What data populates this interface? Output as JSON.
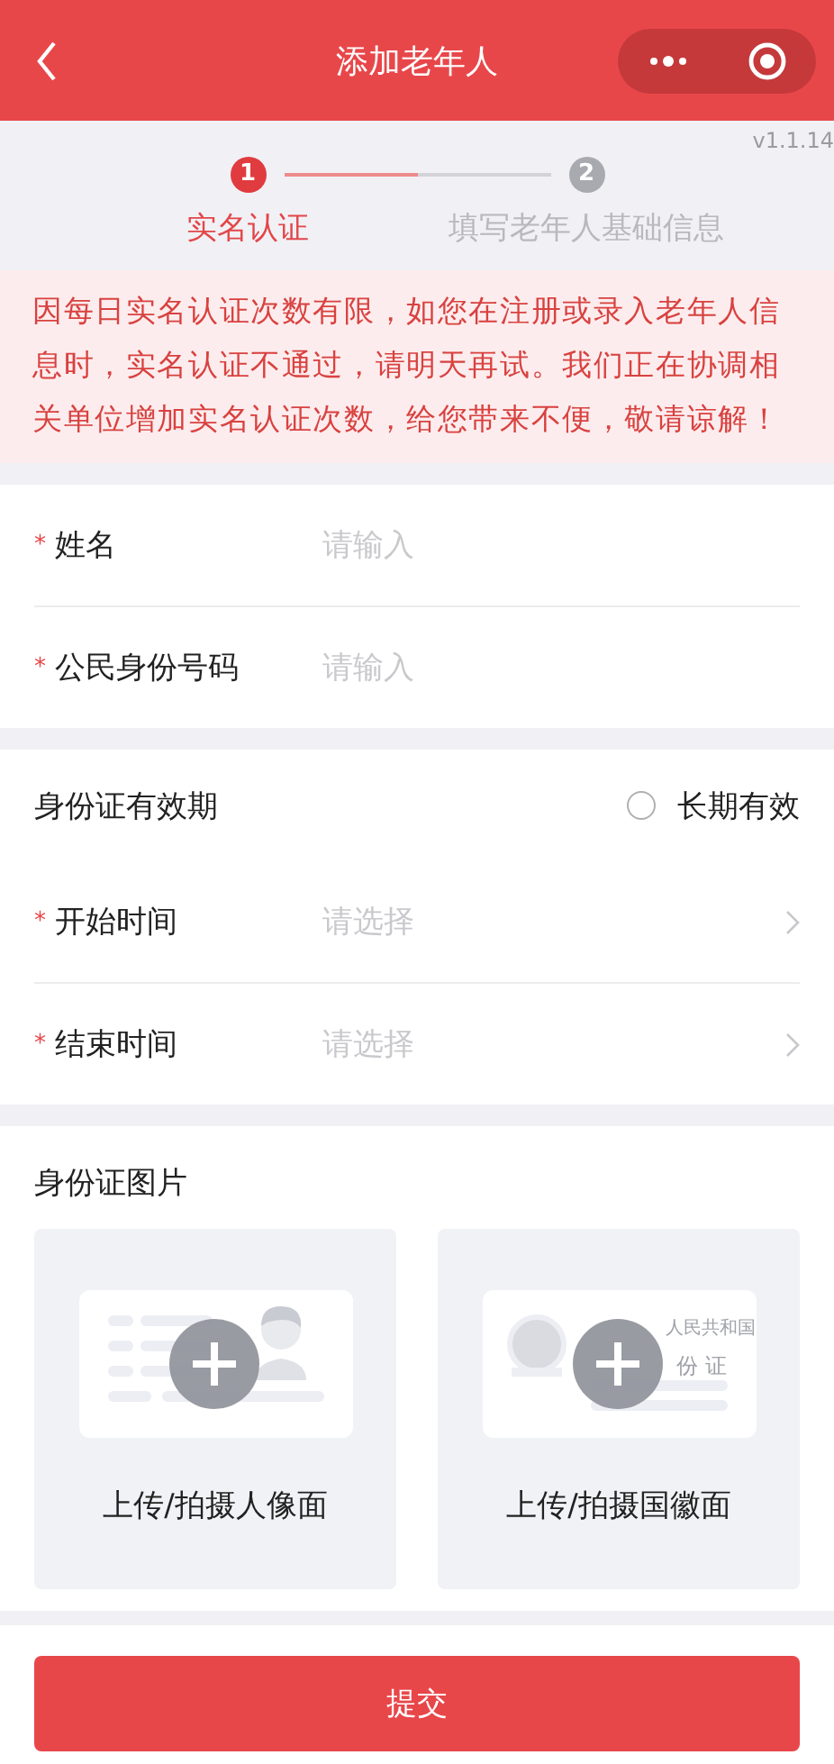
{
  "nav": {
    "title": "添加老年人"
  },
  "version": "v1.1.14",
  "steps": [
    {
      "number": "1",
      "label": "实名认证",
      "selected": true
    },
    {
      "number": "2",
      "label": "填写老年人基础信息",
      "selected": false
    }
  ],
  "step_progress": {
    "level": 0.5
  },
  "notice": "因每日实名认证次数有限，如您在注册或录入老年人信息时，实名认证不通过，请明天再试。我们正在协调相关单位增加实名认证次数，给您带来不便，敬请谅解！",
  "identity_fields": [
    {
      "label": "姓名",
      "mark": "*",
      "placeholder": "请输入"
    },
    {
      "label": "公民身份号码",
      "mark": "*",
      "placeholder": "请输入"
    }
  ],
  "validity": {
    "title": "身份证有效期",
    "long_term": {
      "label": "长期有效",
      "checked": false
    },
    "fields": [
      {
        "label": "开始时间",
        "mark": "*",
        "placeholder": "请选择"
      },
      {
        "label": "结束时间",
        "mark": "*",
        "placeholder": "请选择"
      }
    ]
  },
  "photos": {
    "title": "身份证图片",
    "cards": [
      {
        "kind": "portrait",
        "label": "上传/拍摄人像面"
      },
      {
        "kind": "emblem",
        "label": "上传/拍摄国徽面",
        "card_text": [
          "人民共和国",
          "份证"
        ]
      }
    ]
  },
  "submit": "提交"
}
